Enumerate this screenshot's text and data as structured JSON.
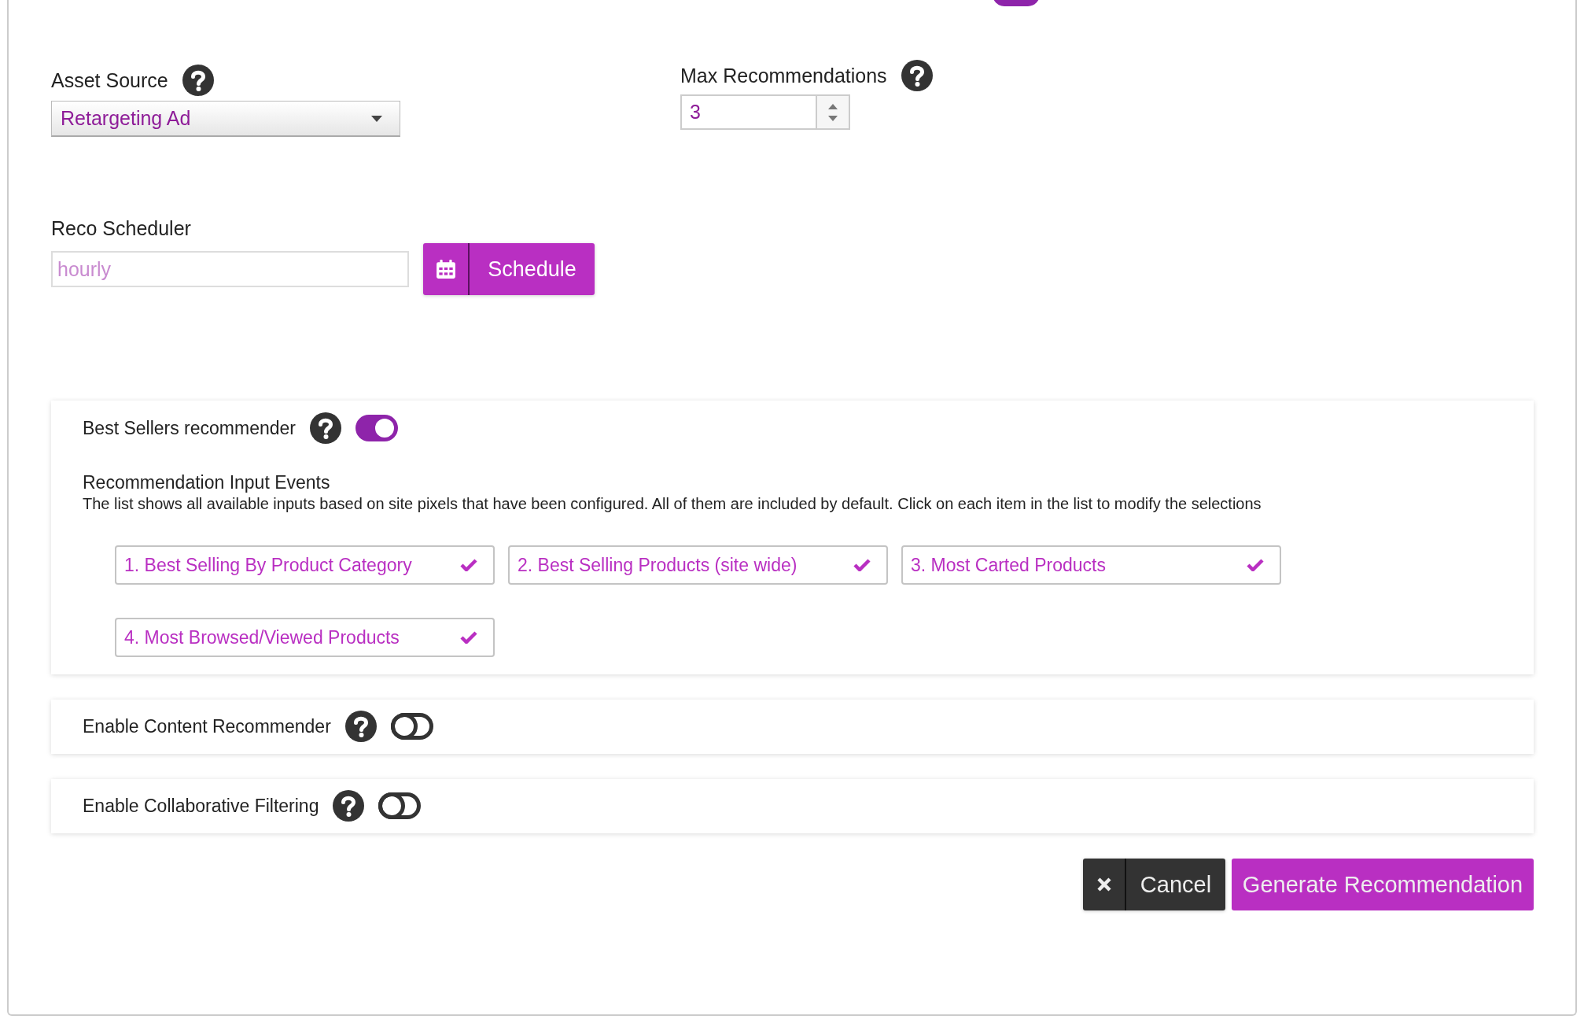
{
  "partial_toggle": {
    "on": true
  },
  "asset_source": {
    "label": "Asset Source",
    "value": "Retargeting Ad"
  },
  "max_recommendations": {
    "label": "Max Recommendations",
    "value": "3"
  },
  "reco_scheduler": {
    "label": "Reco Scheduler",
    "placeholder": "hourly",
    "button": "Schedule"
  },
  "panels": [
    {
      "title": "Best Sellers recommender",
      "on": true,
      "subtitle": "Recommendation Input Events",
      "description": "The list shows all available inputs based on site pixels that have been configured. All of them are included by default. Click on each item in the list to modify the selections",
      "events": [
        {
          "label": "1. Best Selling By Product Category",
          "checked": true
        },
        {
          "label": "2. Best Selling Products (site wide)",
          "checked": true
        },
        {
          "label": "3. Most Carted Products",
          "checked": true
        },
        {
          "label": "4. Most Browsed/Viewed Products",
          "checked": true
        }
      ]
    },
    {
      "title": "Enable Content Recommender",
      "on": false
    },
    {
      "title": "Enable Collaborative Filtering",
      "on": false
    }
  ],
  "buttons": {
    "cancel": "Cancel",
    "generate": "Generate Recommendation"
  }
}
